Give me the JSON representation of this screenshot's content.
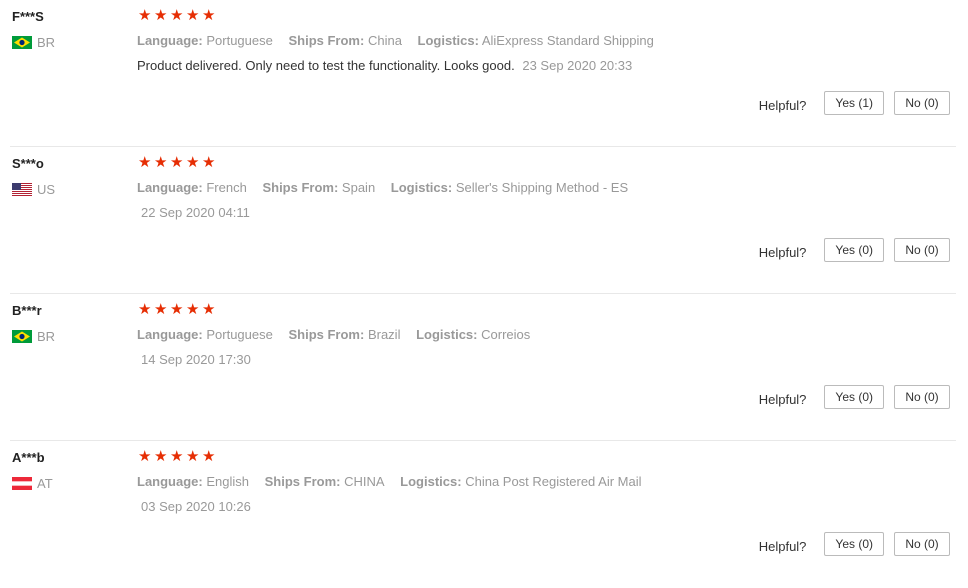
{
  "labels": {
    "language": "Language:",
    "ships_from": "Ships From:",
    "logistics": "Logistics:",
    "helpful": "Helpful?"
  },
  "accent_color": "#e62e04",
  "reviews": [
    {
      "name": "F***S",
      "country": "BR",
      "flag_icon": "brazil-flag-icon",
      "rating": 5,
      "language": "Portuguese",
      "ships_from": "China",
      "logistics": "AliExpress Standard Shipping",
      "text": "Product delivered. Only need to test the functionality. Looks good.",
      "date": "23 Sep 2020 20:33",
      "yes": "Yes (1)",
      "no": "No (0)"
    },
    {
      "name": "S***o",
      "country": "US",
      "flag_icon": "usa-flag-icon",
      "rating": 5,
      "language": "French",
      "ships_from": "Spain",
      "logistics": "Seller's Shipping Method - ES",
      "text": "",
      "date": "22 Sep 2020 04:11",
      "yes": "Yes (0)",
      "no": "No (0)"
    },
    {
      "name": "B***r",
      "country": "BR",
      "flag_icon": "brazil-flag-icon",
      "rating": 5,
      "language": "Portuguese",
      "ships_from": "Brazil",
      "logistics": "Correios",
      "text": "",
      "date": "14 Sep 2020 17:30",
      "yes": "Yes (0)",
      "no": "No (0)"
    },
    {
      "name": "A***b",
      "country": "AT",
      "flag_icon": "austria-flag-icon",
      "rating": 5,
      "language": "English",
      "ships_from": "CHINA",
      "logistics": "China Post Registered Air Mail",
      "text": "",
      "date": "03 Sep 2020 10:26",
      "yes": "Yes (0)",
      "no": "No (0)"
    }
  ]
}
